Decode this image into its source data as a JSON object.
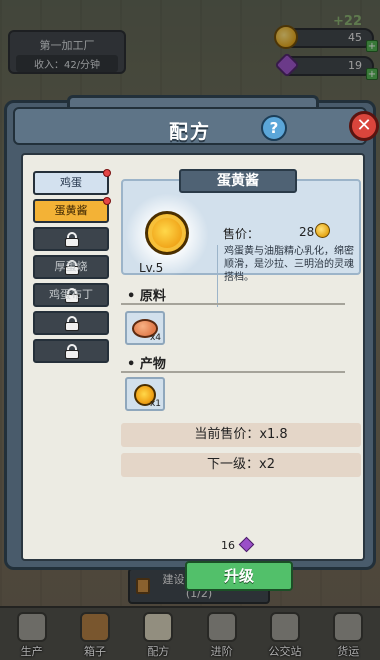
{
  "hud": {
    "factory_name": "第一加工厂",
    "income": "收入：42/分钟",
    "coins": "45",
    "gems": "19",
    "float_text": "+22"
  },
  "dialog": {
    "title": "配方",
    "help": "?",
    "close": "✕"
  },
  "recipes": [
    {
      "label": "鸡蛋",
      "state": "unlocked",
      "dot": true
    },
    {
      "label": "蛋黄酱",
      "state": "selected",
      "dot": true
    },
    {
      "label": "",
      "state": "locked",
      "dot": false
    },
    {
      "label": "厚蛋烧",
      "state": "locked",
      "dot": false
    },
    {
      "label": "鸡蛋布丁",
      "state": "locked",
      "dot": false
    },
    {
      "label": "",
      "state": "locked",
      "dot": false
    },
    {
      "label": "",
      "state": "locked",
      "dot": false
    }
  ],
  "product": {
    "name": "蛋黄酱",
    "level": "Lv.5",
    "price_label": "售价：",
    "price_value": "28",
    "description": "鸡蛋黄与油脂精心乳化，绵密顺滑，是沙拉、三明治的灵魂搭档。"
  },
  "materials": {
    "title": "原料",
    "items": [
      {
        "icon": "egg-icon",
        "qty": "x4"
      }
    ]
  },
  "outputs": {
    "title": "产物",
    "items": [
      {
        "icon": "mayonnaise-icon",
        "qty": "x1"
      }
    ]
  },
  "stats": {
    "current": "当前售价：x1.8",
    "next": "下一级：x2"
  },
  "upgrade": {
    "cost": "16",
    "button": "升级"
  },
  "build": {
    "label": "建设2个加工器",
    "progress": "(1/2)"
  },
  "nav": [
    {
      "label": "生产",
      "icon": "production-icon"
    },
    {
      "label": "箱子",
      "icon": "box-icon"
    },
    {
      "label": "配方",
      "icon": "recipe-book-icon"
    },
    {
      "label": "进阶",
      "icon": "advance-icon"
    },
    {
      "label": "公交站",
      "icon": "bus-stop-icon"
    },
    {
      "label": "货运",
      "icon": "freight-icon"
    }
  ],
  "colors": {
    "panel": "#495b6b",
    "selected": "#f3b236",
    "upgrade": "#52c06a",
    "close": "#d9453c"
  }
}
